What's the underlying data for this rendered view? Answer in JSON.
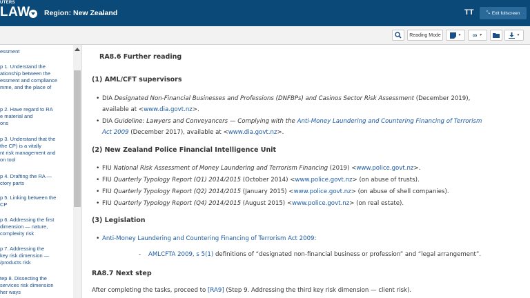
{
  "header": {
    "brand_small": "UTERS",
    "brand_big": "LAW",
    "region": "Region: New Zealand",
    "text_size_icon": "TT",
    "exit_fullscreen": "Exit fullscreen"
  },
  "toolbar": {
    "reading_mode": "Reading Mode"
  },
  "sidebar": {
    "items": [
      {
        "lines": [
          "essment"
        ]
      },
      {
        "lines": [
          "p 1. Understand the",
          "ationship between the",
          "essment and compliance",
          "mme, and the place of"
        ]
      },
      {
        "lines": [
          "p 2. Have regard to RA",
          "e material and",
          "ons"
        ]
      },
      {
        "lines": [
          "p 3. Understand that the",
          "the CP) is a vitally",
          "nt risk management and",
          "on tool"
        ]
      },
      {
        "lines": [
          "p 4. Drafting the RA —",
          "ctory parts"
        ]
      },
      {
        "lines": [
          "p 5. Linking between the",
          "CP"
        ]
      },
      {
        "lines": [
          "p 6. Addressing the first",
          "dimension — nature,",
          "complexity risk"
        ]
      },
      {
        "lines": [
          "p 7. Addressing the",
          "key risk dimension —",
          "/products risk"
        ]
      },
      {
        "lines": [
          "tep 8. Dissecting the",
          "services risk dimension",
          "her ways"
        ]
      }
    ]
  },
  "content": {
    "ra86_title": "RA8.6  Further reading",
    "sec1_title": "(1)  AML/CFT supervisors",
    "sec1_b1_a": "DIA ",
    "sec1_b1_b": "Designated Non-Financial Businesses and Professions (DNFBPs) and Casinos Sector Risk Assessment",
    "sec1_b1_c": " (December 2019),",
    "sec1_b1_line2_a": "available at <",
    "sec1_b1_line2_link": "www.dia.govt.nz",
    "sec1_b1_line2_b": ">.",
    "sec1_b2_a": "DIA ",
    "sec1_b2_b": "Guideline: Lawyers and Conveyancers — Complying with the ",
    "sec1_b2_link": "Anti-Money Laundering and Countering Financing of Terrorism",
    "sec1_b2_line2_link": "Act 2009",
    "sec1_b2_line2_a": " (December 2017), available at <",
    "sec1_b2_line2_link2": "www.dia.govt.nz",
    "sec1_b2_line2_b": ">.",
    "sec2_title": "(2)  New Zealand Police Financial Intelligence Unit",
    "fiu": [
      {
        "pre": "FIU ",
        "title": "National Risk Assessment of Money Laundering and Terrorism Financing",
        "mid": " (2019) <",
        "link": "www.police.govt.nz",
        "post": ">."
      },
      {
        "pre": "FIU ",
        "title": "Quarterly Typology Report (Q1) 2014/2015",
        "mid": " (October 2014) <",
        "link": "www.police.govt.nz",
        "post": "> (on abuse of trusts)."
      },
      {
        "pre": "FIU ",
        "title": "Quarterly Typology Report (Q2) 2014/2015",
        "mid": " (January 2015) <",
        "link": "www.police.govt.nz",
        "post": "> (on abuse of shell companies)."
      },
      {
        "pre": "FIU ",
        "title": "Quarterly Typology Report (Q4) 2014/2015",
        "mid": " (August 2015) <",
        "link": "www.police.govt.nz",
        "post": "> (on real estate)."
      }
    ],
    "sec3_title": "(3)  Legislation",
    "sec3_b1_link": "Anti-Money Laundering and Countering Financing of Terrorism Act 2009",
    "sec3_b1_post": ":",
    "sec3_dash": "-",
    "sec3_sub_link": "AMLCFTA 2009, s 5(1)",
    "sec3_sub_post": " definitions of “designated non-financial business or profession” and “legal arrangement”.",
    "ra87_title": "RA8.7  Next step",
    "next_pre": "After completing the tasks, proceed to ",
    "next_link": "[RA9]",
    "next_post": " (Step 9. Addressing the third key risk dimension — client risk)."
  },
  "colors": {
    "header_bg": "#0b4a78",
    "link": "#1b5aa6",
    "toolbar_icon": "#1b4f8a"
  },
  "icons": [
    "chevron-down-icon",
    "text-size-icon",
    "exit-fullscreen-icon",
    "search-icon",
    "note-icon",
    "link-icon",
    "folder-icon",
    "download-icon"
  ]
}
